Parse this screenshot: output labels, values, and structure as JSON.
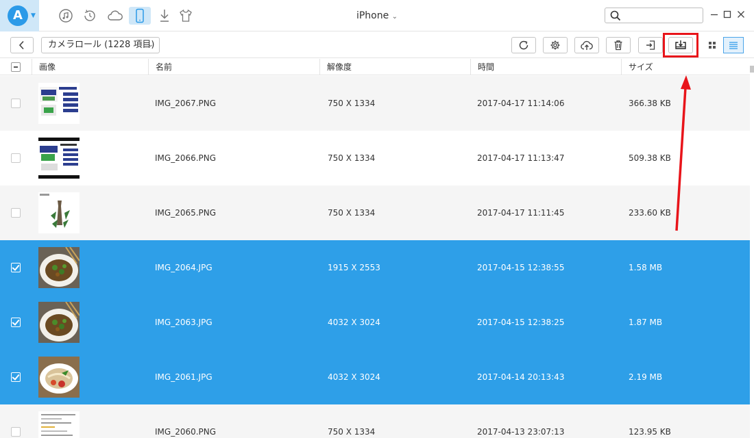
{
  "app": {
    "window_title": "iPhone"
  },
  "nav": {
    "icons": [
      "itunes-library-icon",
      "backup-icon",
      "icloud-icon",
      "device-icon",
      "download-icon",
      "ringtone-icon"
    ]
  },
  "search": {
    "value": "",
    "placeholder": ""
  },
  "toolbar": {
    "album_label": "カメラロール (1228 項目)",
    "highlight_color": "#e8141a"
  },
  "table": {
    "columns": [
      "画像",
      "名前",
      "解像度",
      "時間",
      "サイズ"
    ],
    "rows": [
      {
        "name": "IMG_2067.PNG",
        "resolution": "750 X 1334",
        "time": "2017-04-17 11:14:06",
        "size": "366.38 KB",
        "selected": false,
        "thumb": "doc-blue"
      },
      {
        "name": "IMG_2066.PNG",
        "resolution": "750 X 1334",
        "time": "2017-04-17 11:13:47",
        "size": "509.38 KB",
        "selected": false,
        "thumb": "doc-dark"
      },
      {
        "name": "IMG_2065.PNG",
        "resolution": "750 X 1334",
        "time": "2017-04-17 11:11:45",
        "size": "233.60 KB",
        "selected": false,
        "thumb": "bottle"
      },
      {
        "name": "IMG_2064.JPG",
        "resolution": "1915 X 2553",
        "time": "2017-04-15 12:38:55",
        "size": "1.58 MB",
        "selected": true,
        "thumb": "food"
      },
      {
        "name": "IMG_2063.JPG",
        "resolution": "4032 X 3024",
        "time": "2017-04-15 12:38:25",
        "size": "1.87 MB",
        "selected": true,
        "thumb": "food"
      },
      {
        "name": "IMG_2061.JPG",
        "resolution": "4032 X 3024",
        "time": "2017-04-14 20:13:43",
        "size": "2.19 MB",
        "selected": true,
        "thumb": "noodle"
      },
      {
        "name": "IMG_2060.PNG",
        "resolution": "750 X 1334",
        "time": "2017-04-13 23:07:13",
        "size": "123.95 KB",
        "selected": false,
        "thumb": "text"
      }
    ]
  },
  "colors": {
    "accent": "#2e9fe8",
    "annotation_red": "#e8141a"
  }
}
